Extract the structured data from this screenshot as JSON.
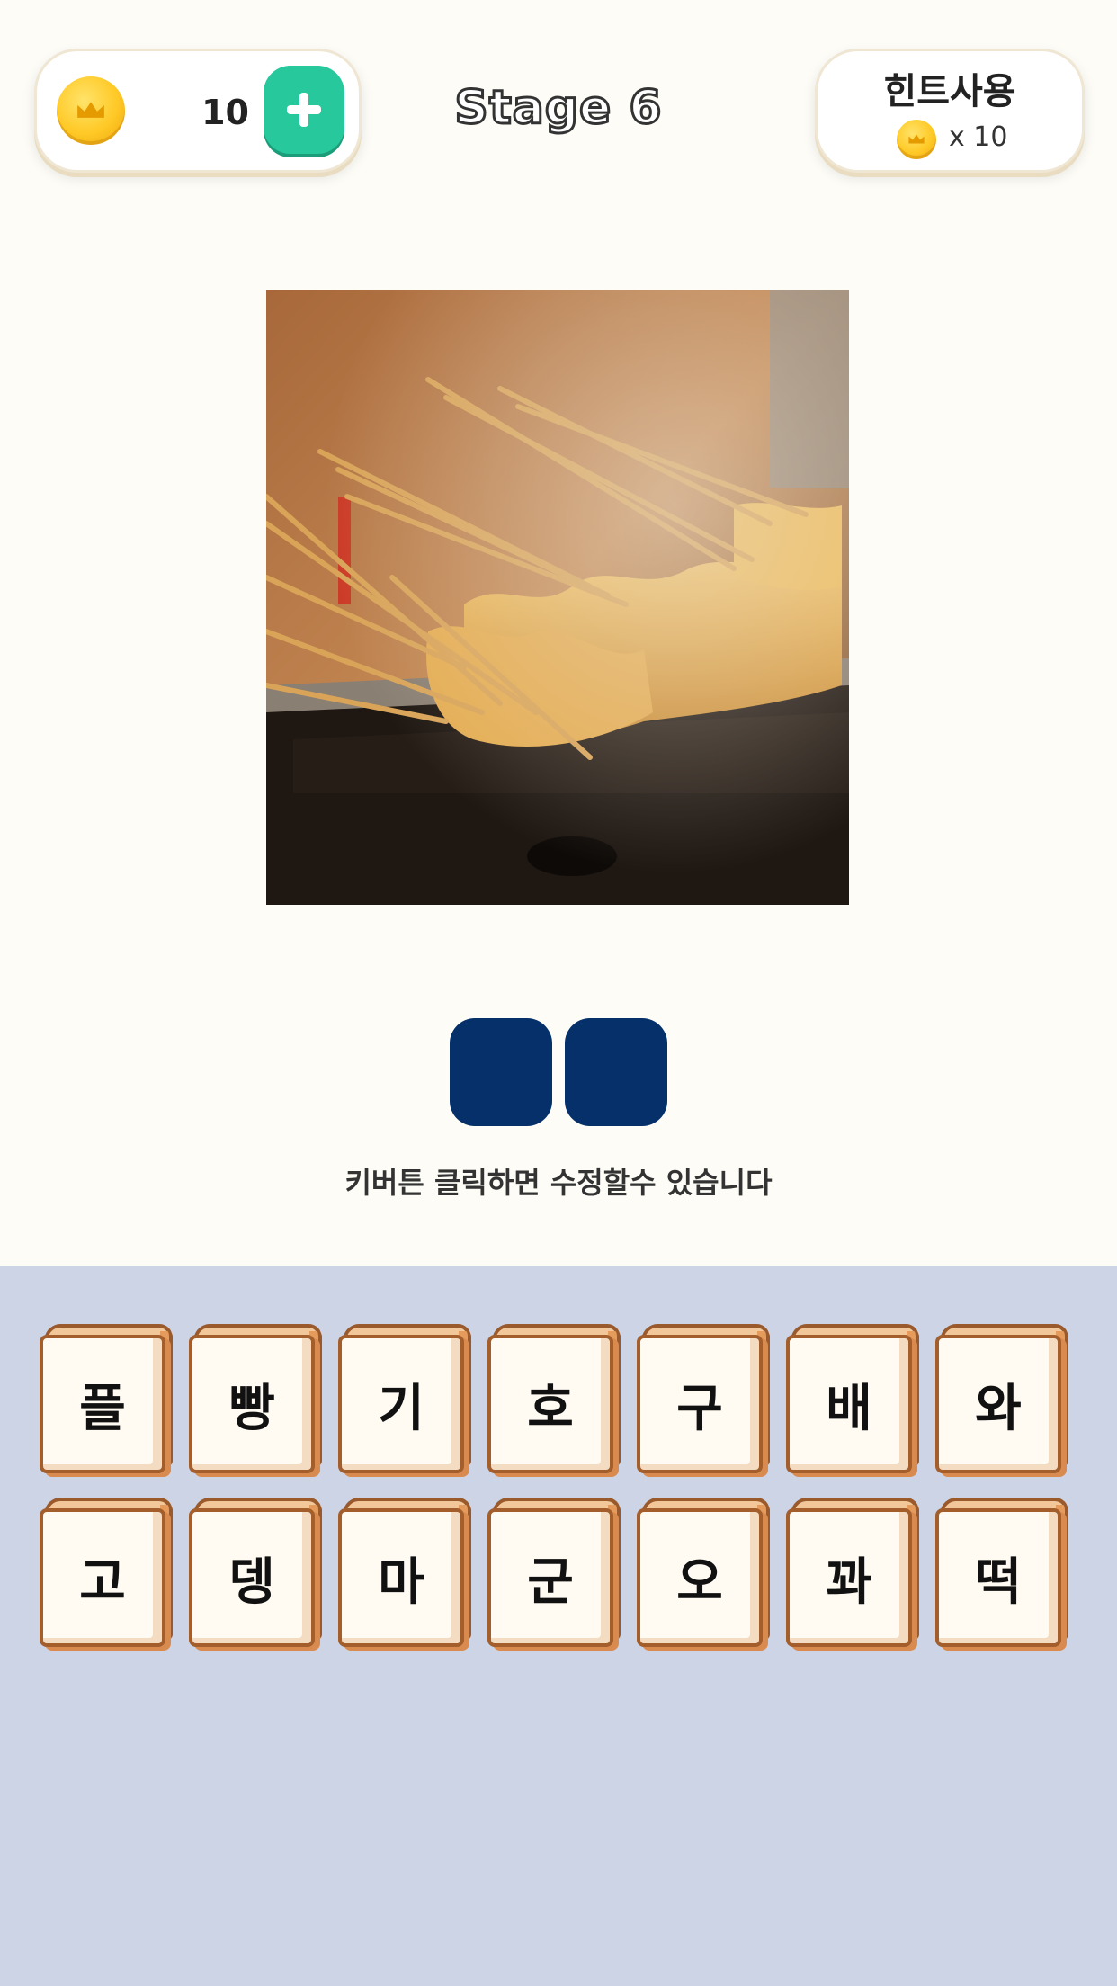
{
  "header": {
    "coin_count": "10",
    "stage_title": "Stage 6",
    "hint_label": "힌트사용",
    "hint_cost": "x 10"
  },
  "answer": {
    "slots": [
      "",
      ""
    ],
    "instruction": "키버튼 클릭하면 수정할수 있습니다"
  },
  "keyboard": {
    "row1": [
      "플",
      "빵",
      "기",
      "호",
      "구",
      "배",
      "와"
    ],
    "row2": [
      "고",
      "뎅",
      "마",
      "군",
      "오",
      "꽈",
      "떡"
    ]
  },
  "colors": {
    "background": "#fdfcf7",
    "keyboard_bg": "#ccd4e6",
    "slot": "#06306a",
    "add_button": "#27c89b",
    "coin": "#ffc926"
  },
  "icons": [
    "coin-icon",
    "crown-icon",
    "plus-icon"
  ]
}
